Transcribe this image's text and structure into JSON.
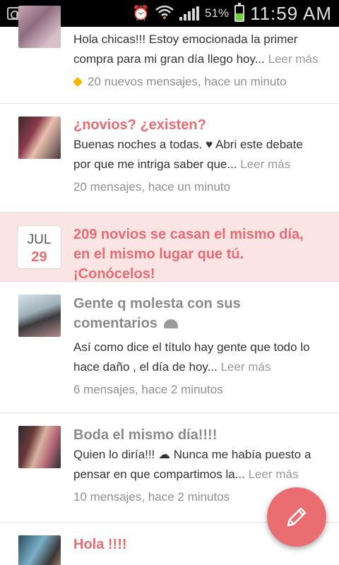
{
  "status_bar": {
    "battery": "51%",
    "time": "11:59 AM",
    "icons": [
      "voicemail-icon",
      "alarm-icon",
      "wifi-icon",
      "signal-icon",
      "battery-icon"
    ]
  },
  "feed": {
    "items": [
      {
        "title": "",
        "body": "Hola chicas!!! Estoy emocionada la primer compra para mi gran día llego hoy...",
        "more": "Leer más",
        "meta": "20 nuevos mensajes, hace un minuto"
      },
      {
        "title": "¿novios? ¿existen?",
        "body": "Buenas noches a todas. ♥ Abri este debate por que me intriga saber que...",
        "more": "Leer más",
        "meta": "20 mensajes, hace un minuto"
      },
      {
        "title": "Gente q molesta con sus comentarios",
        "body": "Así como dice el título hay gente que todo lo hace daño , el día de hoy...",
        "more": "Leer más",
        "meta": "6 mensajes, hace 2 minutos"
      },
      {
        "title": "Boda el mismo día!!!!",
        "body": "Quien lo diría!!! ☁ Nunca me había puesto a pensar en que compartimos la...",
        "more": "Leer más",
        "meta": "10 mensajes, hace 2 minutos"
      },
      {
        "title": "Hola !!!!",
        "body": "",
        "more": "",
        "meta": ""
      }
    ],
    "promo": {
      "month": "JUL",
      "day": "29",
      "text": "209 novios se casan el mismo día, en el mismo lugar que tú. ¡Conócelos!"
    }
  },
  "colors": {
    "accent": "#e86c74",
    "promo_bg": "#fbe5e4",
    "fab": "#ea6d72",
    "new_badge": "#f5b800"
  },
  "fab": {
    "icon": "pencil-icon"
  }
}
